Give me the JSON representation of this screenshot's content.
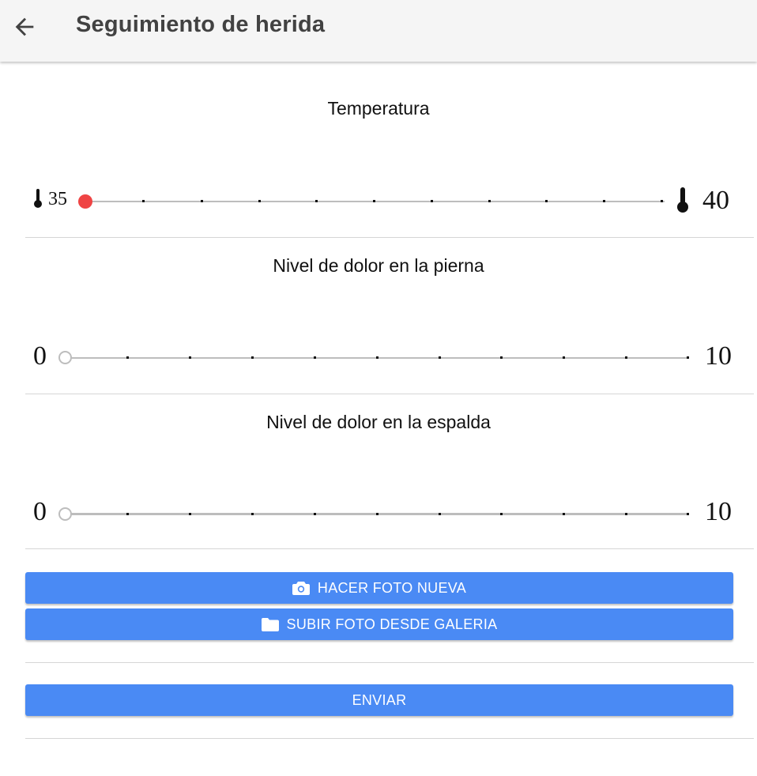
{
  "header": {
    "title": "Seguimiento de herida"
  },
  "sections": [
    {
      "title": "Temperatura",
      "min_label": "35",
      "max_label": "40",
      "value": 35,
      "min": 35,
      "max": 40
    },
    {
      "title": "Nivel de dolor en la pierna",
      "min_label": "0",
      "max_label": "10",
      "value": null,
      "min": 0,
      "max": 10
    },
    {
      "title": "Nivel de dolor en la espalda",
      "min_label": "0",
      "max_label": "10",
      "value": null,
      "min": 0,
      "max": 10
    }
  ],
  "buttons": {
    "take_photo": "HACER FOTO NUEVA",
    "upload_photo": "SUBIR FOTO DESDE GALERIA",
    "send": "ENVIAR"
  },
  "colors": {
    "primary": "#4a8af4",
    "knob_active": "#ef4444",
    "track": "#bdbdbd"
  },
  "icons": [
    "back-arrow-icon",
    "thermometer-icon",
    "camera-icon",
    "folder-icon"
  ]
}
